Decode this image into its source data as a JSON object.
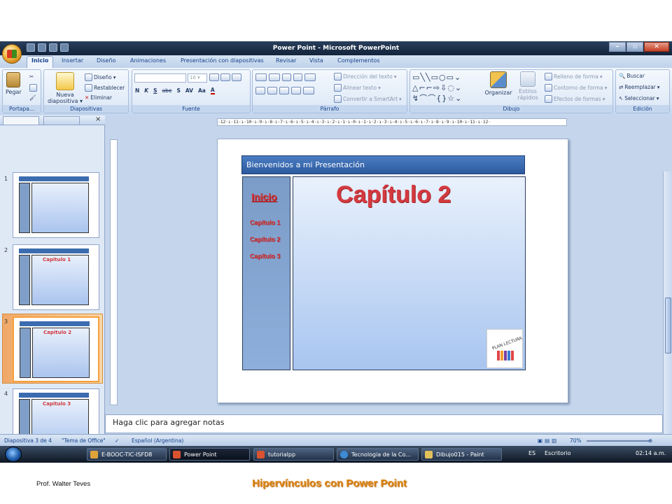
{
  "window": {
    "title": "Power Point - Microsoft PowerPoint"
  },
  "tabs": [
    "Inicio",
    "Insertar",
    "Diseño",
    "Animaciones",
    "Presentación con diapositivas",
    "Revisar",
    "Vista",
    "Complementos"
  ],
  "ribbon": {
    "portapapeles": {
      "label": "Portapa...",
      "pegar": "Pegar"
    },
    "diapositivas": {
      "label": "Diapositivas",
      "nueva": "Nueva",
      "nueva2": "diapositiva",
      "diseno": "Diseño",
      "restablecer": "Restablecer",
      "eliminar": "Eliminar"
    },
    "fuente": {
      "label": "Fuente",
      "size": "16",
      "n": "N",
      "k": "K",
      "s": "S",
      "abc": "abe",
      "sh": "S",
      "av": "AV",
      "aa": "Aa",
      "a": "A"
    },
    "parrafo": {
      "label": "Párrafo",
      "direccion": "Dirección del texto",
      "alinear": "Alinear texto",
      "convertir": "Convertir a SmartArt"
    },
    "dibujo": {
      "label": "Dibujo",
      "organizar": "Organizar",
      "estilos": "Estilos",
      "estilos2": "rápidos",
      "relleno": "Relleno de forma",
      "contorno": "Contorno de forma",
      "efectos": "Efectos de formas"
    },
    "edicion": {
      "label": "Edición",
      "buscar": "Buscar",
      "reemplazar": "Reemplazar",
      "seleccionar": "Seleccionar"
    }
  },
  "ruler": "·12·ı·11·ı·10·ı·9·ı·8·ı·7·ı·6·ı·5·ı·4·ı·3·ı·2·ı·1·ı·0·ı·1·ı·2·ı·3·ı·4·ı·5·ı·6·ı·7·ı·8·ı·9·ı·10·ı·11·ı·12·",
  "thumbnails": [
    {
      "num": "1",
      "title": ""
    },
    {
      "num": "2",
      "title": "Capitulo 1"
    },
    {
      "num": "3",
      "title": "Capitulo 2"
    },
    {
      "num": "4",
      "title": "Capitulo 3"
    }
  ],
  "slide": {
    "header": "Bienvenidos a mi Presentación",
    "inicio": "Inicio",
    "cap1": "Capítulo 1",
    "cap2": "Capítulo 2",
    "cap3": "Capítulo 3",
    "title": "Capítulo 2",
    "logo_text": "PLAN LECTURA"
  },
  "notes_placeholder": "Haga clic para agregar notas",
  "status": {
    "slide": "Diapositiva 3 de 4",
    "theme": "\"Tema de Office\"",
    "lang": "Español (Argentina)",
    "zoom": "70%"
  },
  "taskbar": {
    "items": [
      "E-BOOC-TIC-ISFD8",
      "Power Point",
      "tutorialpp",
      "Tecnologia de la Co...",
      "Dibujo015 - Paint"
    ],
    "lang": "ES",
    "desk": "Escritorio",
    "time": "02:14 a.m."
  },
  "footer": {
    "author": "Prof. Walter Teves",
    "title": "Hipervínculos con Power Point"
  }
}
